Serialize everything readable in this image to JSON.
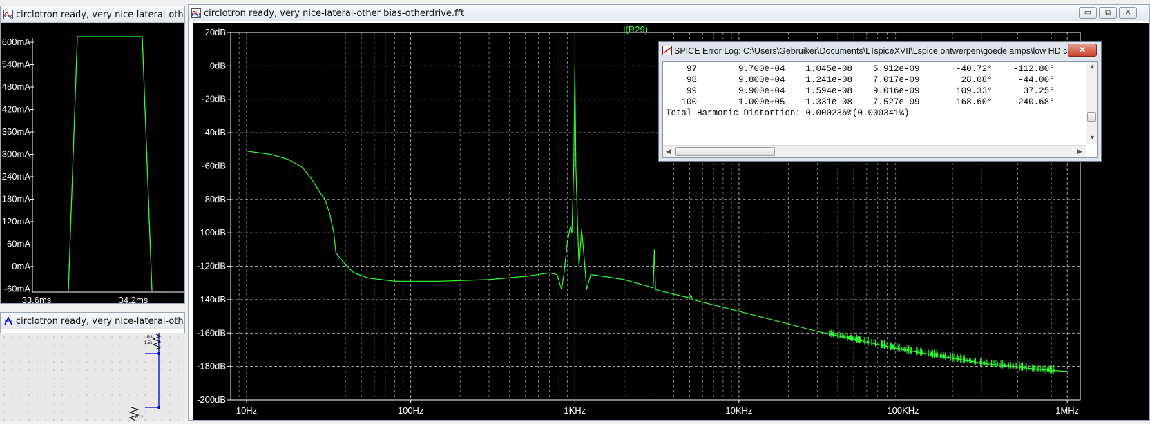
{
  "left_window": {
    "title": "circlotron ready, very nice-lateral-other bias-otherdrive.raw",
    "y_ticks": [
      "600mA",
      "540mA",
      "480mA",
      "420mA",
      "360mA",
      "300mA",
      "240mA",
      "180mA",
      "120mA",
      "60mA",
      "0mA",
      "-60mA"
    ],
    "x_ticks": [
      "33.6ms",
      "34.2ms"
    ],
    "trace_color": "#33ff33"
  },
  "schematic_window": {
    "title": "circlotron ready, very nice-lateral-other bias-otherdrive.asc",
    "components": [
      {
        "name": "R3",
        "value": "1.5k"
      },
      {
        "name": "R12",
        "value": ""
      }
    ]
  },
  "fft_window": {
    "title": "circlotron ready, very nice-lateral-other bias-otherdrive.fft",
    "trace_label": "I(R29)",
    "trace_color": "#33ff33",
    "buttons": {
      "minimize": "▭",
      "restore": "⧉",
      "close": "✕"
    }
  },
  "chart_data": {
    "type": "line",
    "title": "",
    "xlabel": "",
    "ylabel": "",
    "x_scale": "log",
    "xlim": [
      8,
      1200000
    ],
    "ylim": [
      -200,
      20
    ],
    "x_ticks": [
      10,
      100,
      1000,
      10000,
      100000,
      1000000
    ],
    "x_tick_labels": [
      "10Hz",
      "100Hz",
      "1KHz",
      "10KHz",
      "100KHz",
      "1MHz"
    ],
    "y_ticks": [
      20,
      0,
      -20,
      -40,
      -60,
      -80,
      -100,
      -120,
      -140,
      -160,
      -180,
      -200
    ],
    "y_tick_labels": [
      "20dB",
      "0dB",
      "-20dB",
      "-40dB",
      "-60dB",
      "-80dB",
      "-100dB",
      "-120dB",
      "-140dB",
      "-160dB",
      "-180dB",
      "-200dB"
    ],
    "grid": true,
    "series": [
      {
        "name": "I(R29)",
        "x": [
          10,
          14,
          18,
          22,
          25,
          28,
          30,
          32,
          34,
          35,
          37,
          40,
          45,
          55,
          80,
          150,
          300,
          500,
          700,
          780,
          830,
          860,
          900,
          940,
          960,
          985,
          1000,
          1015,
          1040,
          1060,
          1100,
          1140,
          1180,
          1250,
          1500,
          2000,
          2800,
          3000,
          3050,
          3100,
          5000,
          5100,
          5200,
          10000,
          30000,
          100000,
          300000,
          700000,
          1000000
        ],
        "y": [
          -51,
          -53,
          -56,
          -61,
          -68,
          -76,
          -80,
          -88,
          -100,
          -112,
          -115,
          -119,
          -124,
          -127,
          -129,
          -129,
          -128,
          -126,
          -124,
          -125,
          -134,
          -124,
          -106,
          -96,
          -100,
          -60,
          0,
          -60,
          -96,
          -120,
          -98,
          -115,
          -134,
          -125,
          -126,
          -128,
          -132,
          -133,
          -110,
          -134,
          -139,
          -137,
          -140,
          -147,
          -159,
          -170,
          -178,
          -182,
          -183
        ]
      }
    ]
  },
  "error_log": {
    "title": "SPICE Error Log: C:\\Users\\Gebruiker\\Documents\\LTspiceXVII\\Lspice ontwerpen\\goede amps\\low HD circl...",
    "close_label": "✕",
    "rows": [
      {
        "n": "97",
        "freq": "9.700e+04",
        "mag": "1.045e-08",
        "norm": "5.912e-09",
        "phase": "-40.72°",
        "nphase": "-112.80°"
      },
      {
        "n": "98",
        "freq": "9.800e+04",
        "mag": "1.241e-08",
        "norm": "7.017e-09",
        "phase": "28.08°",
        "nphase": "-44.00°"
      },
      {
        "n": "99",
        "freq": "9.900e+04",
        "mag": "1.594e-08",
        "norm": "9.016e-09",
        "phase": "109.33°",
        "nphase": "37.25°"
      },
      {
        "n": "100",
        "freq": "1.000e+05",
        "mag": "1.331e-08",
        "norm": "7.527e-09",
        "phase": "-168.60°",
        "nphase": "-240.68°"
      }
    ],
    "thd_line": "Total Harmonic Distortion: 0.000236%(0.000341%)"
  }
}
